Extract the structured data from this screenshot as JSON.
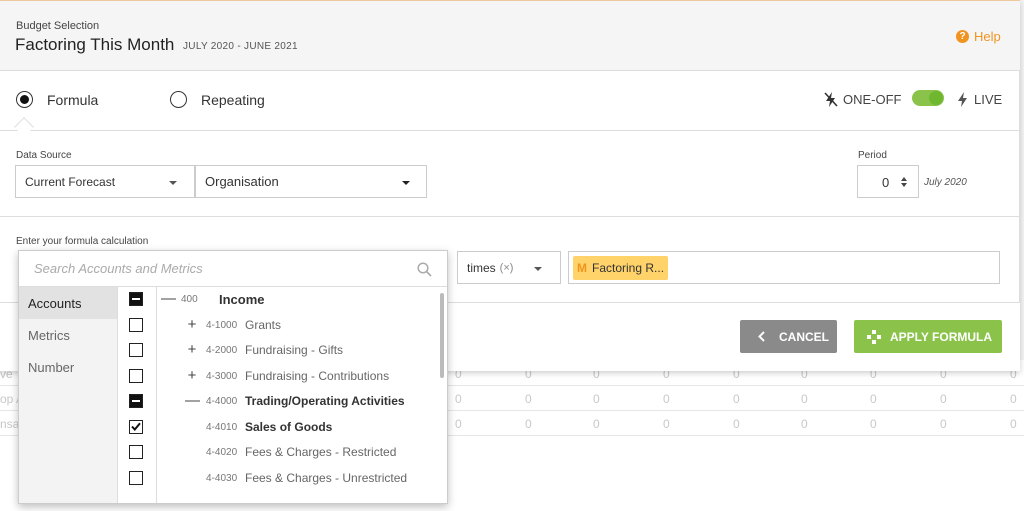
{
  "header": {
    "subtitle": "Budget Selection",
    "title": "Factoring This Month",
    "date_range": "JULY 2020 - JUNE 2021",
    "help_label": "Help"
  },
  "mode_tabs": {
    "formula_label": "Formula",
    "repeating_label": "Repeating",
    "selected": "Formula"
  },
  "mode_toggle": {
    "oneoff_label": "ONE-OFF",
    "live_label": "LIVE"
  },
  "data_source": {
    "label": "Data Source",
    "source_value": "Current Forecast",
    "scope_value": "Organisation"
  },
  "period": {
    "label": "Period",
    "value": "0",
    "month": "July 2020"
  },
  "formula": {
    "label": "Enter your formula calculation",
    "operator_value": "times",
    "operator_clear": "(×)",
    "chip_prefix": "M",
    "chip_label": "Factoring R..."
  },
  "buttons": {
    "cancel": "CANCEL",
    "apply": "APPLY FORMULA"
  },
  "picker": {
    "search_placeholder": "Search Accounts and Metrics",
    "categories": [
      "Accounts",
      "Metrics",
      "Number"
    ],
    "active_category": "Accounts",
    "tree": [
      {
        "state": "partial",
        "expander": "—",
        "code": "400",
        "name": "Income",
        "level": 0,
        "bold": true
      },
      {
        "state": "unchecked",
        "expander": "+",
        "code": "4-1000",
        "name": "Grants",
        "level": 1,
        "bold": false
      },
      {
        "state": "unchecked",
        "expander": "+",
        "code": "4-2000",
        "name": "Fundraising - Gifts",
        "level": 1,
        "bold": false
      },
      {
        "state": "unchecked",
        "expander": "+",
        "code": "4-3000",
        "name": "Fundraising - Contributions",
        "level": 1,
        "bold": false
      },
      {
        "state": "partial",
        "expander": "—",
        "code": "4-4000",
        "name": "Trading/Operating Activities",
        "level": 1,
        "bold": true
      },
      {
        "state": "checked",
        "expander": "",
        "code": "4-4010",
        "name": "Sales of Goods",
        "level": 2,
        "bold": true
      },
      {
        "state": "unchecked",
        "expander": "",
        "code": "4-4020",
        "name": "Fees & Charges - Restricted",
        "level": 2,
        "bold": false
      },
      {
        "state": "unchecked",
        "expander": "",
        "code": "4-4030",
        "name": "Fees & Charges - Unrestricted",
        "level": 2,
        "bold": false
      }
    ]
  },
  "background_table": {
    "rows": [
      {
        "label": "ve",
        "values": [
          "0",
          "0",
          "0",
          "0",
          "0",
          "0",
          "0",
          "0",
          "0",
          "0"
        ]
      },
      {
        "label": "op A",
        "values": [
          "0",
          "0",
          "0",
          "0",
          "0",
          "0",
          "0",
          "0",
          "0",
          "0"
        ]
      },
      {
        "label": "nsa",
        "values": [
          "0",
          "0",
          "0",
          "0",
          "0",
          "0",
          "0",
          "0",
          "0",
          "0"
        ]
      }
    ]
  },
  "colors": {
    "accent_green": "#8bc34a",
    "accent_orange": "#f0941f",
    "chip_yellow": "#ffd36a"
  }
}
